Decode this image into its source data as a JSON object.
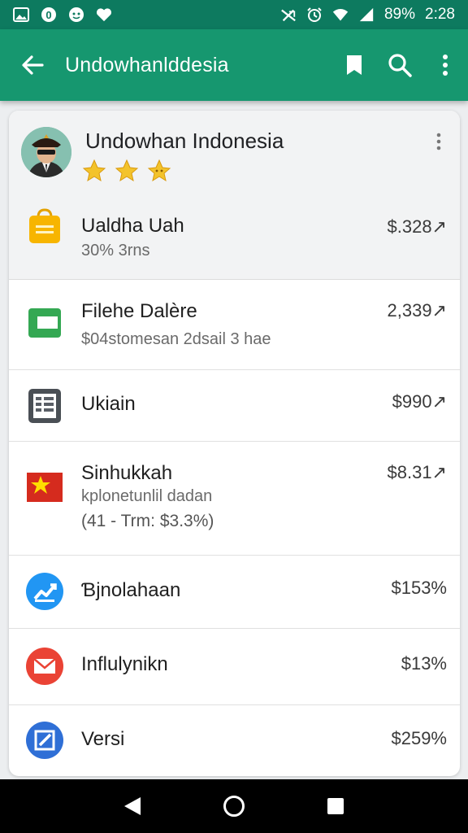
{
  "status_bar": {
    "battery": "89%",
    "time": "2:28",
    "left_icons": [
      "gallery-icon",
      "sync-icon",
      "chat-icon",
      "heart-icon"
    ],
    "right_icons": [
      "no-signal-icon",
      "alarm-icon",
      "wifi-icon",
      "signal-icon"
    ]
  },
  "app_bar": {
    "title": "Undowhanlddesia",
    "actions": [
      "bookmark-icon",
      "search-icon",
      "more-vert-icon"
    ],
    "color": "#16976f"
  },
  "header": {
    "title": "Undowhan Indonesia",
    "rating_stars": 3
  },
  "rows": [
    {
      "title": "Ualdha Uah",
      "subtitle": "30% 3rns",
      "value": "$.328↗",
      "icon": "shopping-bag-icon",
      "icon_color": "#f5b301"
    },
    {
      "title": "Filehe Dalère",
      "subtitle": "$04stomesan 2dsail 3 hae",
      "value": "2,339↗",
      "icon": "green-card-icon",
      "icon_color": "#34a853"
    },
    {
      "title": "Ukiain",
      "value": "$990↗",
      "icon": "ledger-icon",
      "icon_color": "#4a4f55"
    },
    {
      "title": "Sinhukkah",
      "subtitle": "kplonetunlil dadan",
      "subtitle2": "(41 - Trm: $3.3%)",
      "value": "$8.31↗",
      "icon": "star-flag-icon",
      "icon_color": "#d52b1e"
    },
    {
      "title": "Ɓjnolahaan",
      "value": "$153%",
      "icon": "chart-circle-icon",
      "icon_color": "#2196f3"
    },
    {
      "title": "Influlynikn",
      "value": "$13%",
      "icon": "mail-circle-icon",
      "icon_color": "#ea4335"
    },
    {
      "title": "Versi",
      "value": "$259%",
      "icon": "edit-circle-icon",
      "icon_color": "#2f6fd6"
    }
  ]
}
